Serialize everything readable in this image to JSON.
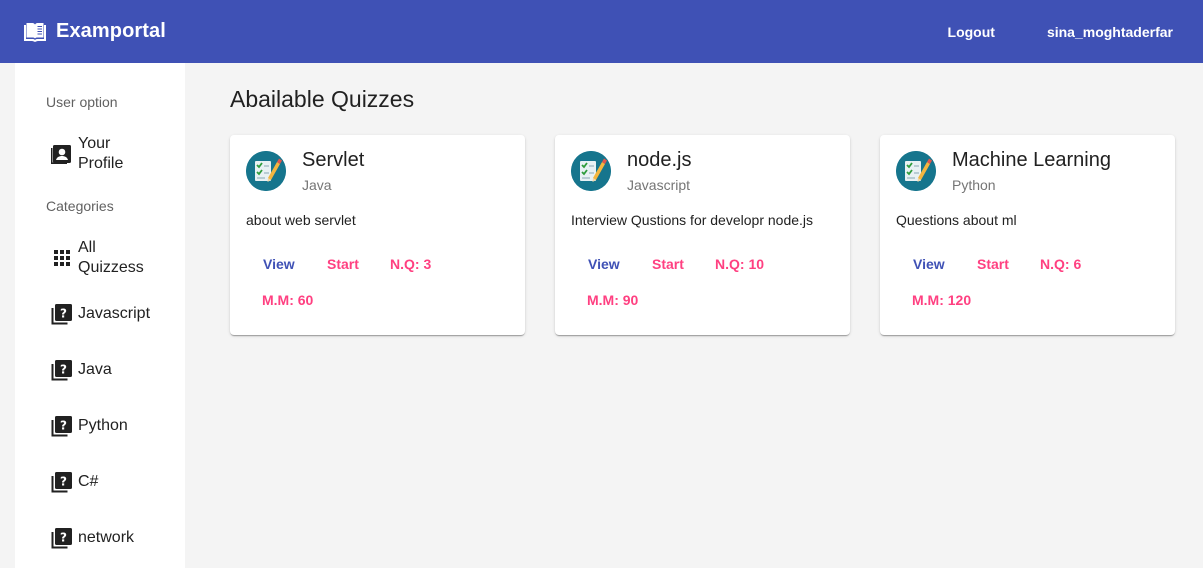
{
  "app": {
    "title": "Examportal"
  },
  "header": {
    "logout_label": "Logout",
    "username": "sina_moghtaderfar"
  },
  "colors": {
    "primary": "#3f51b5",
    "accent": "#ff4081",
    "avatar_bg": "#16758d"
  },
  "sidebar": {
    "user_heading": "User option",
    "profile_label": "Your\nProfile",
    "categories_heading": "Categories",
    "all_label": "All\nQuizzess",
    "categories": [
      {
        "label": "Javascript",
        "icon": "quiz-icon"
      },
      {
        "label": "Java",
        "icon": "quiz-icon"
      },
      {
        "label": "Python",
        "icon": "quiz-icon"
      },
      {
        "label": "C#",
        "icon": "quiz-icon"
      },
      {
        "label": "network",
        "icon": "quiz-icon"
      }
    ]
  },
  "main": {
    "title": "Abailable Quizzes",
    "quizzes": [
      {
        "title": "Servlet",
        "category": "Java",
        "description": "about web servlet",
        "view_label": "View",
        "start_label": "Start",
        "nq_label": "N.Q: 3",
        "mm_label": "M.M: 60"
      },
      {
        "title": "node.js",
        "category": "Javascript",
        "description": "Interview Qustions for developr node.js",
        "view_label": "View",
        "start_label": "Start",
        "nq_label": "N.Q: 10",
        "mm_label": "M.M: 90"
      },
      {
        "title": "Machine Learning",
        "category": "Python",
        "description": "Questions about ml",
        "view_label": "View",
        "start_label": "Start",
        "nq_label": "N.Q: 6",
        "mm_label": "M.M: 120"
      }
    ]
  }
}
